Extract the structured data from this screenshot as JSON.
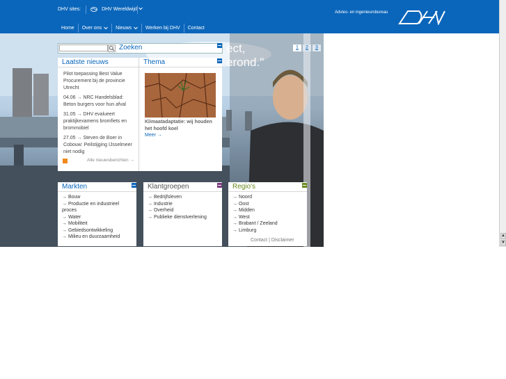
{
  "topbar": {
    "sites_label": "DHV sites:",
    "sites_select": "DHV Wereldwijd",
    "tagline": "Advies- en ingenieursbureau",
    "nav": [
      "Home",
      "Over ons",
      "Nieuws",
      "Werken bij DHV",
      "Contact"
    ],
    "nav_dropdown": [
      false,
      true,
      true,
      false,
      false
    ]
  },
  "hero": {
    "quote_line1": "ect,",
    "quote_line2": "erond.\"",
    "pager": [
      "1",
      "2",
      "3"
    ]
  },
  "search": {
    "label": "Zoeken",
    "value": ""
  },
  "news": {
    "title": "Laatste nieuws",
    "items": [
      {
        "date": "",
        "text": "Pilot toepassing Best Value Procurement bij de provincie Utrecht"
      },
      {
        "date": "04.06",
        "text": "NRC Handelsblad: Beton burgers voor hun afval"
      },
      {
        "date": "31.05",
        "text": "DHV evalueert praktijkexamens bromfiets en brommobiel"
      },
      {
        "date": "27.05",
        "text": "Steven de Boer in Cobouw: Peilstijging IJsselmeer niet nodig"
      }
    ],
    "all_link": "Alle nieuwsberichten"
  },
  "theme": {
    "title": "Thema",
    "caption": "Klimaatadaptatie: wij houden het hoofd koel",
    "more": "Meer"
  },
  "markten": {
    "title": "Markten",
    "accent": "#0a66bb",
    "items": [
      "Bouw",
      "Productie en industrieel proces",
      "Water",
      "Mobiliteit",
      "Gebiedsontwikkeling",
      "Milieu en duurzaamheid"
    ]
  },
  "klantgroepen": {
    "title": "Klantgroepen",
    "accent": "#7a3b7e",
    "items": [
      "Bedrijfsleven",
      "Industrie",
      "Overheid",
      "Publieke dienstverlening"
    ]
  },
  "regios": {
    "title": "Regio's",
    "accent": "#6a8a1f",
    "items": [
      "Noord",
      "Oost",
      "Midden",
      "West",
      "Brabant / Zeeland",
      "Limburg"
    ]
  },
  "footer": {
    "contact": "Contact",
    "disclaimer": "Disclaimer"
  }
}
